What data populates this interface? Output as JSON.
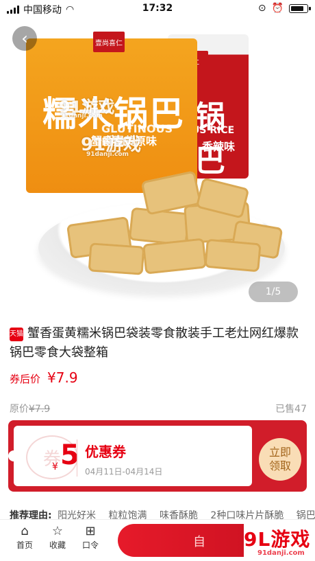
{
  "status_bar": {
    "carrier": "中国移动",
    "time": "17:32"
  },
  "hero": {
    "back_icon": "chevron-left-icon",
    "pager": "1/5",
    "bag_orange": {
      "brand": "壹尚喜仁",
      "text": "糯米锅巴",
      "sub": "GLUTINOUS RICE",
      "flavor": "蟹香蛋黄原味"
    },
    "bag_red": {
      "brand": "喜仁",
      "text": "锅巴",
      "sub": "US RICE",
      "flavor": "香辣味"
    },
    "watermark1": "91游戏",
    "watermark1_small": "91danji.com",
    "watermark2": "91游戏",
    "watermark2_small": "91danji.com"
  },
  "product": {
    "store_badge": "天猫",
    "title": "蟹香蛋黄糯米锅巴袋装零食散装手工老灶网红爆款锅巴零食大袋整箱",
    "coupon_price_label": "券后价",
    "coupon_price": "¥7.9",
    "original_label": "原价",
    "original_price": "¥7.9",
    "sold": "已售47"
  },
  "coupon": {
    "seal": "券",
    "currency": "¥",
    "amount": "5",
    "name": "优惠券",
    "dates": "04月11日-04月14日",
    "claim": "立即\n领取"
  },
  "recommend": {
    "label": "推荐理由:",
    "items": [
      "阳光好米",
      "粒粒饱满",
      "味香酥脆",
      "2种口味片片酥脆",
      "锅巴"
    ]
  },
  "tabbar": {
    "home": "首页",
    "fav": "收藏",
    "code": "口令",
    "buy_label": "自"
  },
  "brand_mark": {
    "logo": "9L游戏",
    "site": "91danji.com"
  }
}
